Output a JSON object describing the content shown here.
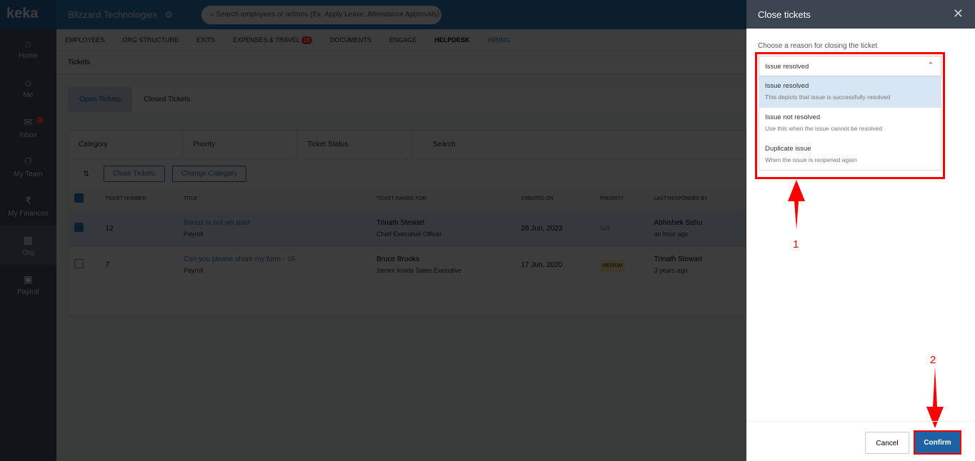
{
  "sidebar": {
    "logo": "keka",
    "items": [
      {
        "label": "Home",
        "icon": "⌂"
      },
      {
        "label": "Me",
        "icon": "☺"
      },
      {
        "label": "Inbox",
        "icon": "✉",
        "badge": "1"
      },
      {
        "label": "My Team",
        "icon": "⚇"
      },
      {
        "label": "My Finances",
        "icon": "₹"
      },
      {
        "label": "Org",
        "icon": "▦"
      },
      {
        "label": "Payroll",
        "icon": "▣"
      }
    ]
  },
  "header": {
    "company": "Blizzard Technologies",
    "search_placeholder": "Search employees or actions (Ex: Apply Leave, Attendance Approvals)"
  },
  "menu": [
    {
      "label": "EMPLOYEES"
    },
    {
      "label": "ORG STRUCTURE"
    },
    {
      "label": "EXITS"
    },
    {
      "label": "EXPENSES & TRAVEL",
      "badge": "18"
    },
    {
      "label": "DOCUMENTS"
    },
    {
      "label": "ENGAGE"
    },
    {
      "label": "HELPDESK"
    },
    {
      "label": "HIRING"
    }
  ],
  "subtab": "Tickets",
  "tabs": [
    "Open Tickets",
    "Closed Tickets"
  ],
  "filters": [
    "Category",
    "Priority",
    "Ticket Status",
    "Search"
  ],
  "actions": {
    "close": "Close Tickets",
    "change": "Change Category"
  },
  "columns": [
    "TICKET NUMBER",
    "TITLE",
    "TICKET RAISED FOR",
    "CREATED ON",
    "PRIORITY",
    "LAST RESPONDED BY"
  ],
  "rows": [
    {
      "num": "12",
      "title": "Bonus is not yet paid",
      "cat": "Payroll",
      "name": "Trinath Stewart",
      "role": "Chief Executive Officer",
      "date": "28 Jun, 2023",
      "priority": "NA",
      "resp": "Abhishek Sahu",
      "ago": "an hour ago"
    },
    {
      "num": "7",
      "title": "Can you please share my form - 16",
      "cat": "Payroll",
      "name": "Bruce Brooks",
      "role": "Senior Inside Sales Executive",
      "date": "17 Jun, 2020",
      "priority": "MEDIUM",
      "resp": "Trinath Stewart",
      "ago": "3 years ago"
    }
  ],
  "panel": {
    "title": "Close tickets",
    "label": "Choose a reason for closing the ticket",
    "selected": "Issue resolved",
    "options": [
      {
        "title": "Issue resolved",
        "desc": "This depicts that issue is successfully resolved"
      },
      {
        "title": "Issue not resolved",
        "desc": "Use this when the issue cannot be resolved"
      },
      {
        "title": "Duplicate issue",
        "desc": "When the issue is reopened again"
      }
    ],
    "cancel": "Cancel",
    "confirm": "Confirm"
  },
  "annotations": [
    "1",
    "2"
  ]
}
